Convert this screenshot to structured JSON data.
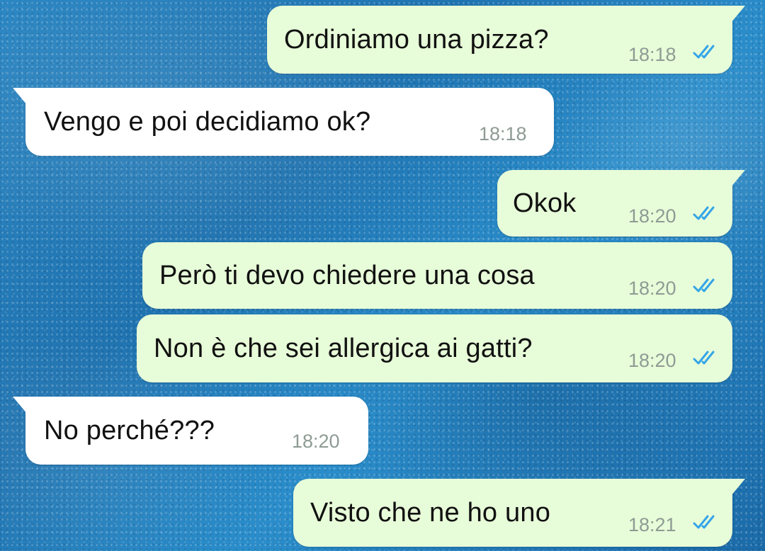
{
  "chat": {
    "messages": [
      {
        "direction": "outgoing",
        "text": "Ordiniamo una pizza?",
        "time": "18:18",
        "status_icon": "double-check-icon"
      },
      {
        "direction": "incoming",
        "text": "Vengo e poi decidiamo ok?",
        "time": "18:18"
      },
      {
        "direction": "outgoing",
        "text": "Okok",
        "time": "18:20",
        "status_icon": "double-check-icon"
      },
      {
        "direction": "outgoing",
        "text": "Però ti devo chiedere una cosa",
        "time": "18:20",
        "status_icon": "double-check-icon"
      },
      {
        "direction": "outgoing",
        "text": "Non è che sei allergica ai gatti?",
        "time": "18:20",
        "status_icon": "double-check-icon"
      },
      {
        "direction": "incoming",
        "text": "No perché???",
        "time": "18:20"
      },
      {
        "direction": "outgoing",
        "text": "Visto che ne ho uno",
        "time": "18:21",
        "status_icon": "double-check-icon"
      }
    ]
  },
  "colors": {
    "outgoing_bubble": "#e7fcd8",
    "incoming_bubble": "#ffffff",
    "read_tick": "#34a5e8",
    "timestamp": "#8e9b94",
    "wallpaper": "#2479b8"
  }
}
